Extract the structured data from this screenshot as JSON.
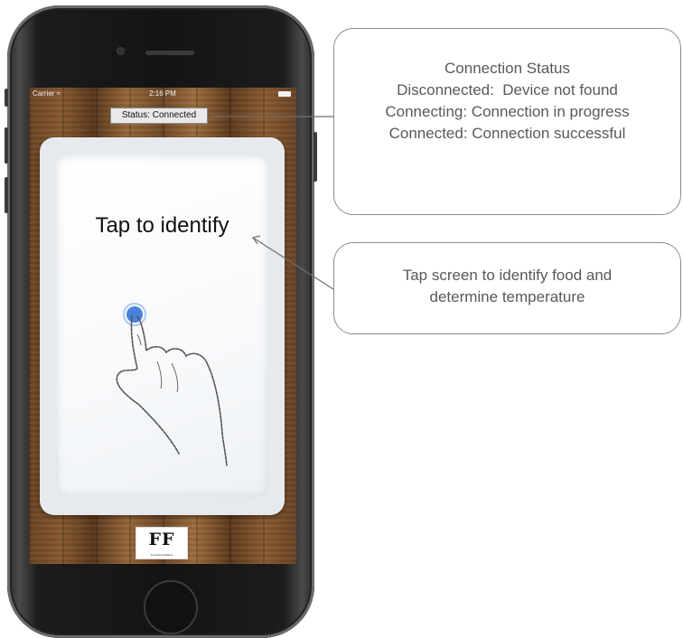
{
  "status_bar": {
    "carrier": "Carrier ≈",
    "time": "2:16 PM"
  },
  "app": {
    "status_label": "Status: Connected",
    "tap_prompt": "Tap to identify",
    "logo": {
      "letters": "FF",
      "tagline": "Functional Platters"
    },
    "hand_icon": "hand-pointer-icon"
  },
  "callouts": {
    "connection_status": {
      "title": "Connection Status",
      "lines": [
        "Disconnected:  Device not found",
        "Connecting: Connection in progress",
        "Connected: Connection successful"
      ]
    },
    "tap_screen": {
      "lines": [
        "Tap screen to identify food and",
        "determine temperature"
      ]
    }
  },
  "colors": {
    "callout_text": "#595959",
    "callout_border": "#8c8c8c",
    "touch_dot": "#2a6bd8"
  }
}
